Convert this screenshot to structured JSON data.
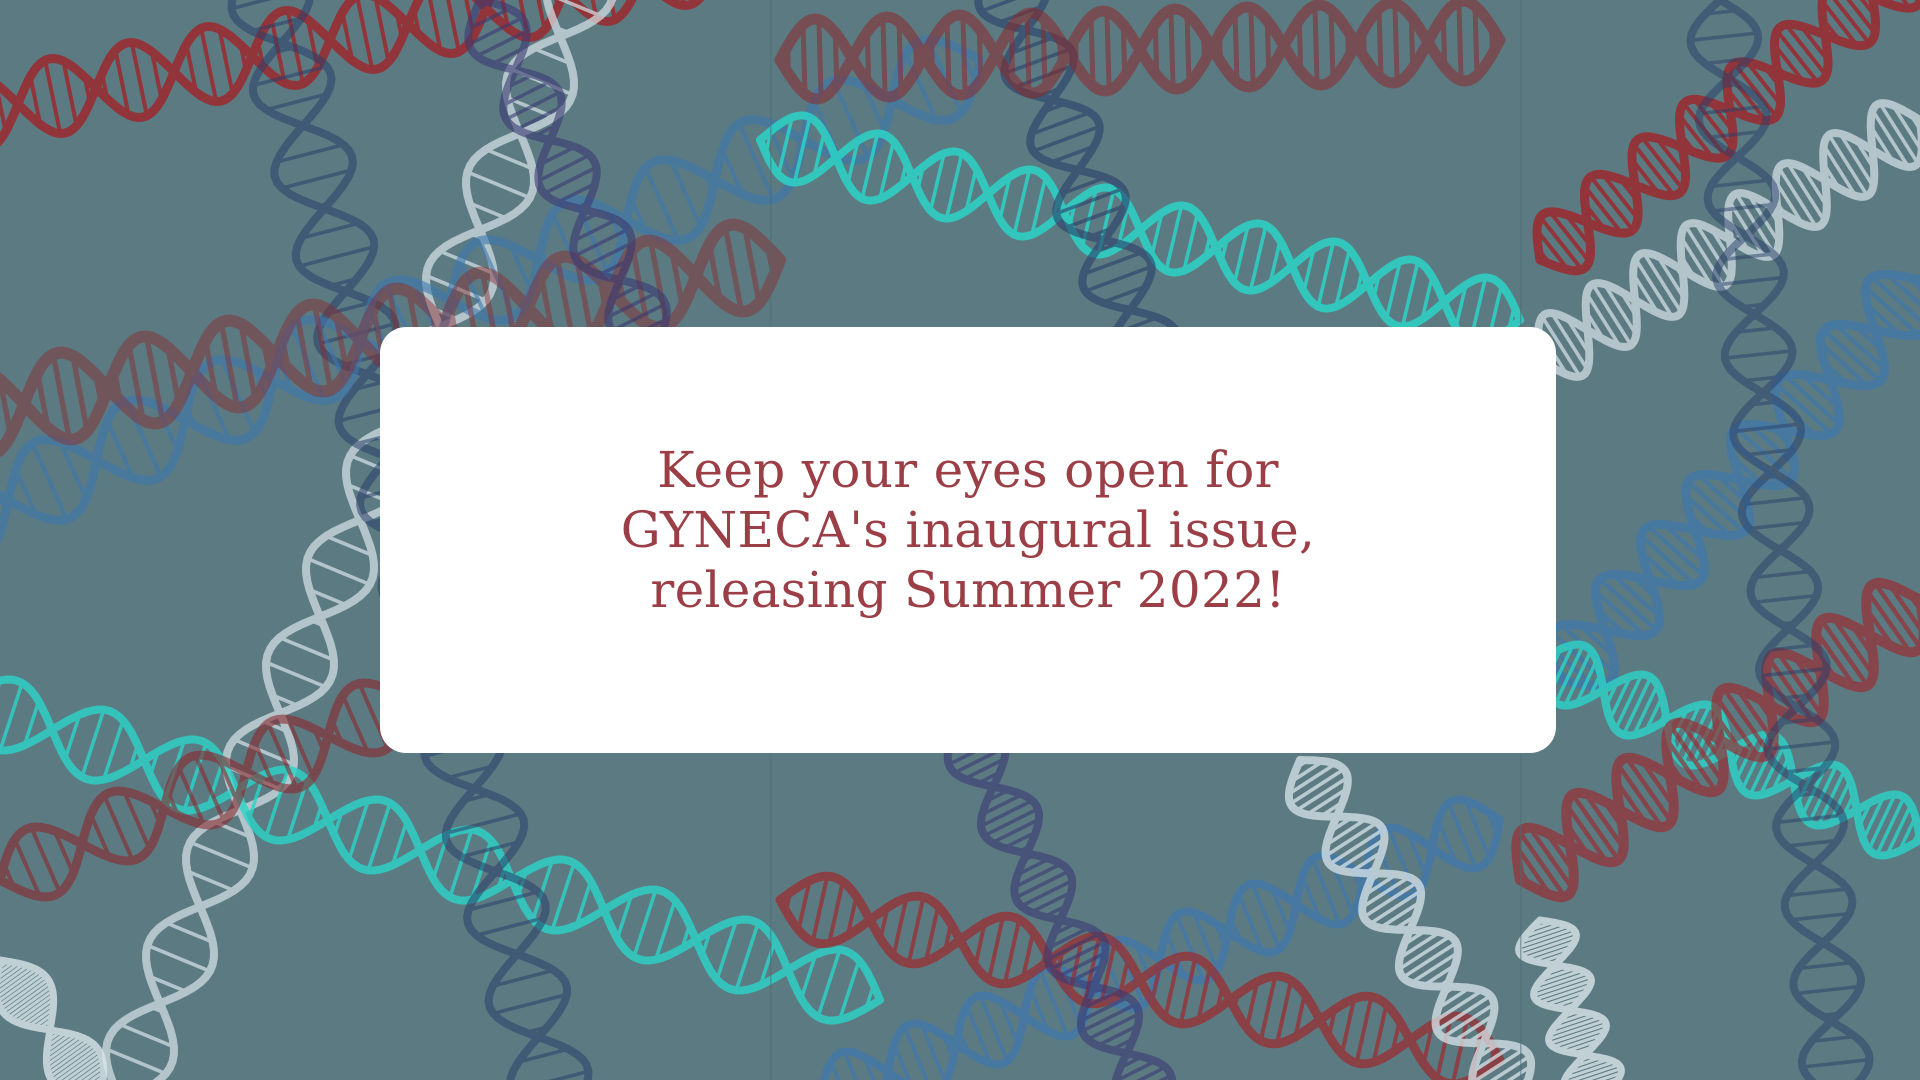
{
  "background": {
    "image": "dna-double-helix-pattern",
    "base_color": "#5c7a82",
    "helix_colors": [
      "#9c2a2e",
      "#8a2a2e",
      "#d9e6ea",
      "#2a3f6a",
      "#3d78b0",
      "#2bd4c8",
      "#3a3a72"
    ]
  },
  "announcement": {
    "lines": [
      "Keep your eyes open for",
      "GYNECA's inaugural issue,",
      "releasing Summer 2022!"
    ],
    "text_color": "#9b3e46",
    "card_color": "#ffffff"
  }
}
